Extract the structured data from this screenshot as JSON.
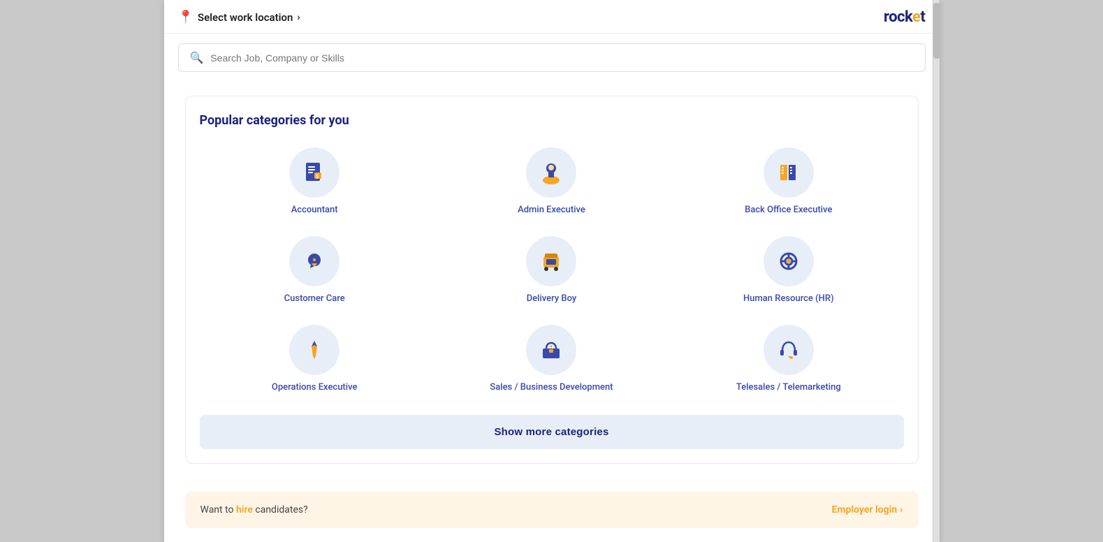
{
  "header": {
    "location_label": "Select work location",
    "chevron": "›",
    "logo": "rocket"
  },
  "search": {
    "placeholder": "Search Job, Company or Skills"
  },
  "categories_section": {
    "title": "Popular categories for you",
    "items": [
      {
        "id": "accountant",
        "label": "Accountant",
        "icon": "accountant"
      },
      {
        "id": "admin-executive",
        "label": "Admin Executive",
        "icon": "admin"
      },
      {
        "id": "back-office-executive",
        "label": "Back Office Executive",
        "icon": "backoffice"
      },
      {
        "id": "customer-care",
        "label": "Customer Care",
        "icon": "customercare"
      },
      {
        "id": "delivery-boy",
        "label": "Delivery Boy",
        "icon": "delivery"
      },
      {
        "id": "human-resource",
        "label": "Human Resource (HR)",
        "icon": "hr"
      },
      {
        "id": "operations-executive",
        "label": "Operations Executive",
        "icon": "operations"
      },
      {
        "id": "sales-business",
        "label": "Sales / Business Development",
        "icon": "sales"
      },
      {
        "id": "telesales",
        "label": "Telesales / Telemarketing",
        "icon": "telesales"
      }
    ],
    "show_more_label": "Show more categories"
  },
  "employer_banner": {
    "text": "Want to hire candidates?",
    "link_label": "Employer login",
    "chevron": "›"
  }
}
